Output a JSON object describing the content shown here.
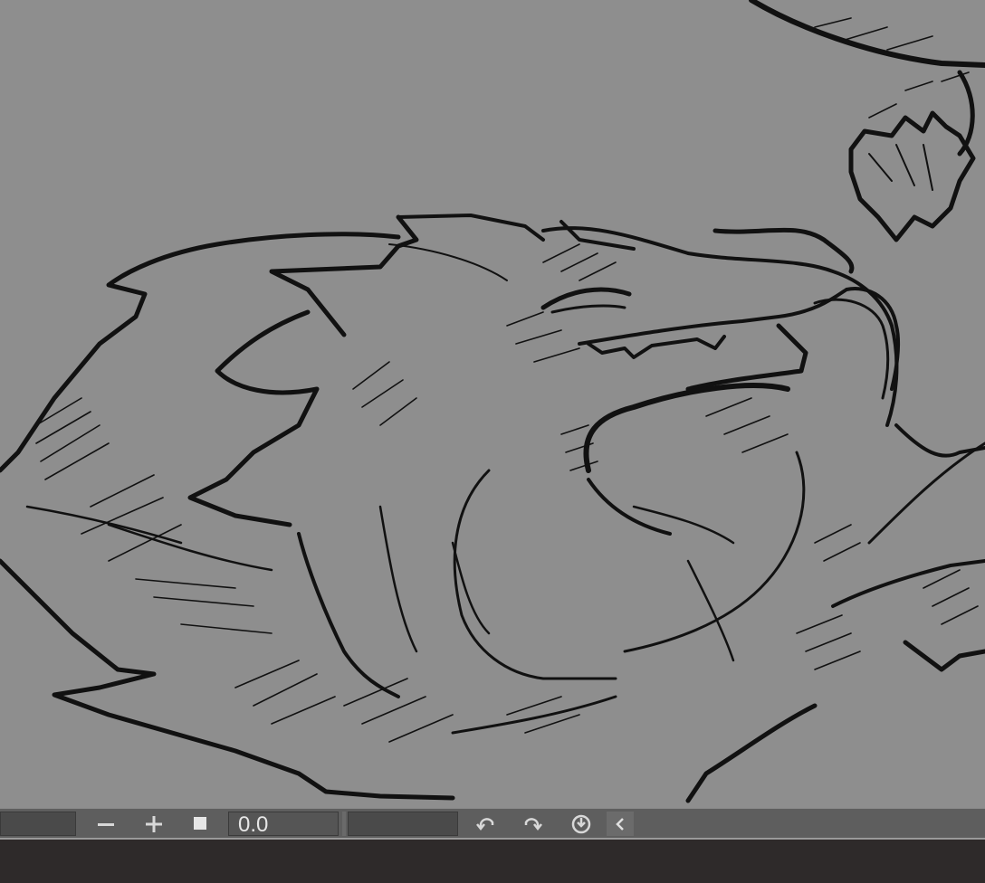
{
  "canvas": {
    "background": "#8e8e8e",
    "ink": "#111111",
    "subject": "wolf-sketch"
  },
  "statusbar": {
    "zoom_out_icon": "minus-icon",
    "zoom_in_icon": "plus-icon",
    "fit_icon": "square-icon",
    "rotation_value": "0.0",
    "rotate_left_icon": "rotate-left-icon",
    "rotate_right_icon": "rotate-right-icon",
    "reset_rotation_icon": "reset-rotation-icon",
    "collapse_icon": "chevron-left-icon"
  },
  "colors": {
    "statusbar_bg": "#5e5e5e",
    "field_bg": "#4a4a4a",
    "icon": "#d8d8d8",
    "panel_bg": "#2e2a2a"
  }
}
